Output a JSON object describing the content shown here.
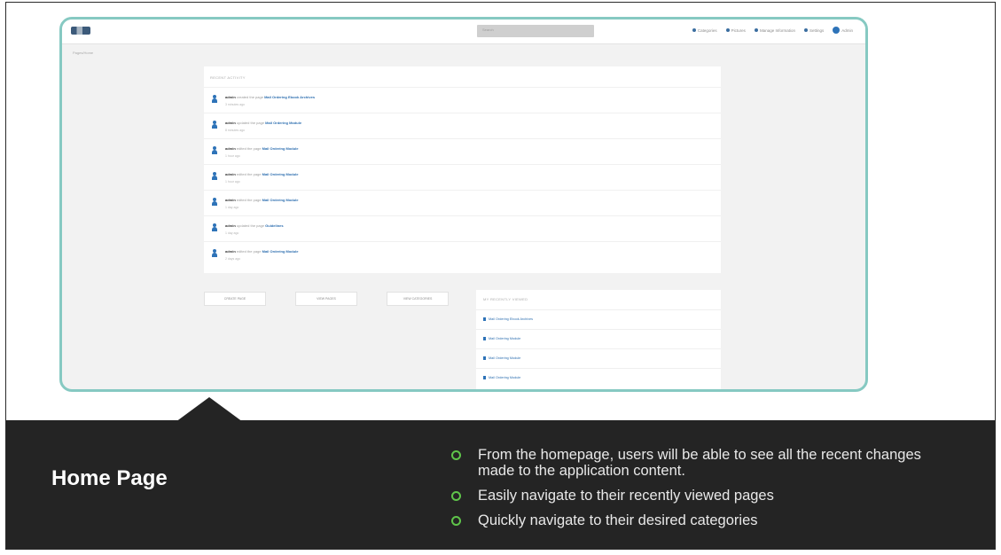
{
  "device": {
    "logo_text": "",
    "search_placeholder": "Search",
    "nav": [
      {
        "label": "Categories",
        "icon": "list-icon"
      },
      {
        "label": "Pictures",
        "icon": "image-icon"
      },
      {
        "label": "Manage Information",
        "icon": "folder-icon"
      },
      {
        "label": "Settings",
        "icon": "gear-icon"
      },
      {
        "label": "Admin",
        "icon": "user-icon"
      }
    ],
    "breadcrumb": "Pages/Home",
    "activity_title": "RECENT ACTIVITY",
    "activity": [
      {
        "user": "admin",
        "action": "created the page",
        "target": "Mail Ordering Ebook Archives",
        "meta": "3 minutes ago"
      },
      {
        "user": "admin",
        "action": "updated the page",
        "target": "Mail Ordering Module",
        "meta": "8 minutes ago"
      },
      {
        "user": "admin",
        "action": "edited the page",
        "target": "Mail Ordering Module",
        "meta": "1 hour ago"
      },
      {
        "user": "admin",
        "action": "edited the page",
        "target": "Mail Ordering Module",
        "meta": "1 hour ago"
      },
      {
        "user": "admin",
        "action": "edited the page",
        "target": "Mail Ordering Module",
        "meta": "1 day ago"
      },
      {
        "user": "admin",
        "action": "updated the page",
        "target": "Guidelines",
        "meta": "1 day ago"
      },
      {
        "user": "admin",
        "action": "edited the page",
        "target": "Mail Ordering Module",
        "meta": "2 days ago"
      }
    ],
    "quick_buttons": [
      "CREATE PAGE",
      "VIEW PAGES",
      "VIEW CATEGORIES"
    ],
    "recent_title": "MY RECENTLY VIEWED",
    "recent": [
      "Mail Ordering Ebook Archives",
      "Mail Ordering Module",
      "Mail Ordering Module",
      "Mail Ordering Module"
    ]
  },
  "slide": {
    "title": "Home Page",
    "bullets": [
      "From the homepage, users will be able to see all the recent changes made to the application content.",
      "Easily navigate to their recently viewed pages",
      "Quickly navigate to their desired categories"
    ]
  },
  "colors": {
    "device_border": "#86c9c2",
    "band_bg": "#242424",
    "bullet_accent": "#5fc44a",
    "link_blue": "#2e6fb0"
  }
}
